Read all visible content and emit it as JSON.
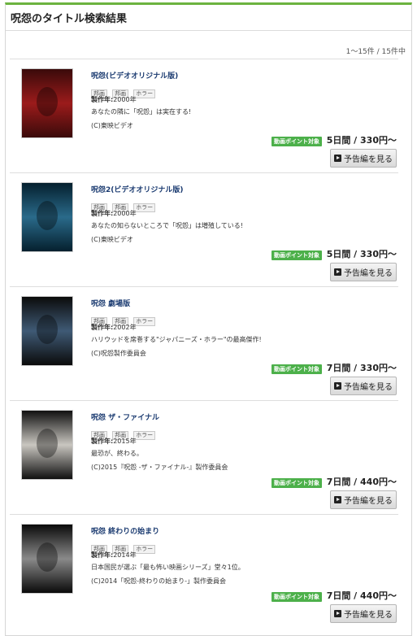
{
  "header": {
    "title": "呪怨のタイトル検索結果"
  },
  "result_count": "1～15件 /  15件中",
  "results": [
    {
      "title": "呪怨(ビデオオリジナル版)",
      "tags": [
        "邦画",
        "邦画",
        "ホラー"
      ],
      "year_label": "製作年:",
      "year": "2000年",
      "description": "あなたの隣に「呪怨」は実在する!",
      "copyright": "(C)東映ビデオ",
      "point_badge": "動画ポイント対象",
      "price": "5日間 / 330円～",
      "trailer_button": "予告編を見る",
      "poster_colors": [
        "#3a0a0a",
        "#9b1b1b"
      ]
    },
    {
      "title": "呪怨2(ビデオオリジナル版)",
      "tags": [
        "邦画",
        "邦画",
        "ホラー"
      ],
      "year_label": "製作年:",
      "year": "2000年",
      "description": "あなたの知らないところで「呪怨」は増殖している!",
      "copyright": "(C)東映ビデオ",
      "point_badge": "動画ポイント対象",
      "price": "5日間 / 330円～",
      "trailer_button": "予告編を見る",
      "poster_colors": [
        "#05202e",
        "#2a6a8a"
      ]
    },
    {
      "title": "呪怨 劇場版",
      "tags": [
        "邦画",
        "邦画",
        "ホラー"
      ],
      "year_label": "製作年:",
      "year": "2002年",
      "description": "ハリウッドを席巻する\"ジャパニーズ・ホラー\"の最高傑作!",
      "copyright": "(C)呪怨製作委員会",
      "point_badge": "動画ポイント対象",
      "price": "7日間 / 330円～",
      "trailer_button": "予告編を見る",
      "poster_colors": [
        "#0b0b0b",
        "#3f5a75"
      ]
    },
    {
      "title": "呪怨 ザ・ファイナル",
      "tags": [
        "邦画",
        "邦画",
        "ホラー"
      ],
      "year_label": "製作年:",
      "year": "2015年",
      "description": "最恐が、終わる。",
      "copyright": "(C)2015『呪怨 -ザ・ファイナル-』製作委員会",
      "point_badge": "動画ポイント対象",
      "price": "7日間 / 440円～",
      "trailer_button": "予告編を見る",
      "poster_colors": [
        "#101010",
        "#c9c6c0"
      ]
    },
    {
      "title": "呪怨 終わりの始まり",
      "tags": [
        "邦画",
        "邦画",
        "ホラー"
      ],
      "year_label": "製作年:",
      "year": "2014年",
      "description": "日本国民が選ぶ「最も怖い映画シリーズ」堂々1位。",
      "copyright": "(C)2014「呪怨-終わりの始まり-」製作委員会",
      "point_badge": "動画ポイント対象",
      "price": "7日間 / 440円～",
      "trailer_button": "予告編を見る",
      "poster_colors": [
        "#0a0a0a",
        "#8a8a8a"
      ]
    }
  ]
}
